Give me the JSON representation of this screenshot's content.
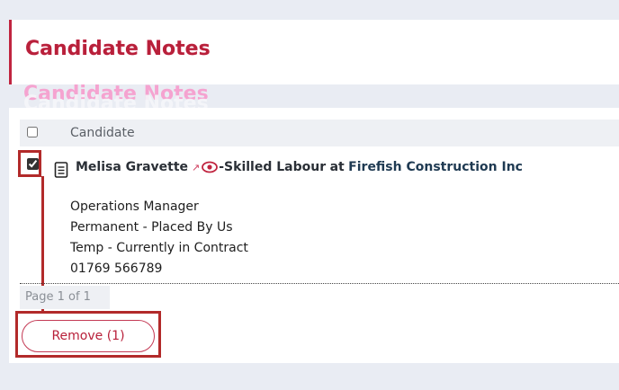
{
  "header": {
    "title": "Candidate Notes"
  },
  "ghost_titles": [
    "Candidate Notes",
    "Candidate Notes"
  ],
  "table": {
    "column": "Candidate",
    "row": {
      "checked": true,
      "name": "Melisa Gravette",
      "ext_icon": "external-link-icon",
      "eye_icon": "eye-icon",
      "job_title": "-Skilled Labour",
      "at_word": "at",
      "company": "Firefish Construction Inc",
      "details": [
        "Operations Manager",
        "Permanent - Placed By Us",
        "Temp - Currently in Contract",
        "01769 566789"
      ]
    }
  },
  "pager": {
    "text": "Page 1 of 1"
  },
  "actions": {
    "remove_label": "Remove (1)"
  },
  "colors": {
    "accent": "#c0243f",
    "highlight": "#b22a2a"
  }
}
